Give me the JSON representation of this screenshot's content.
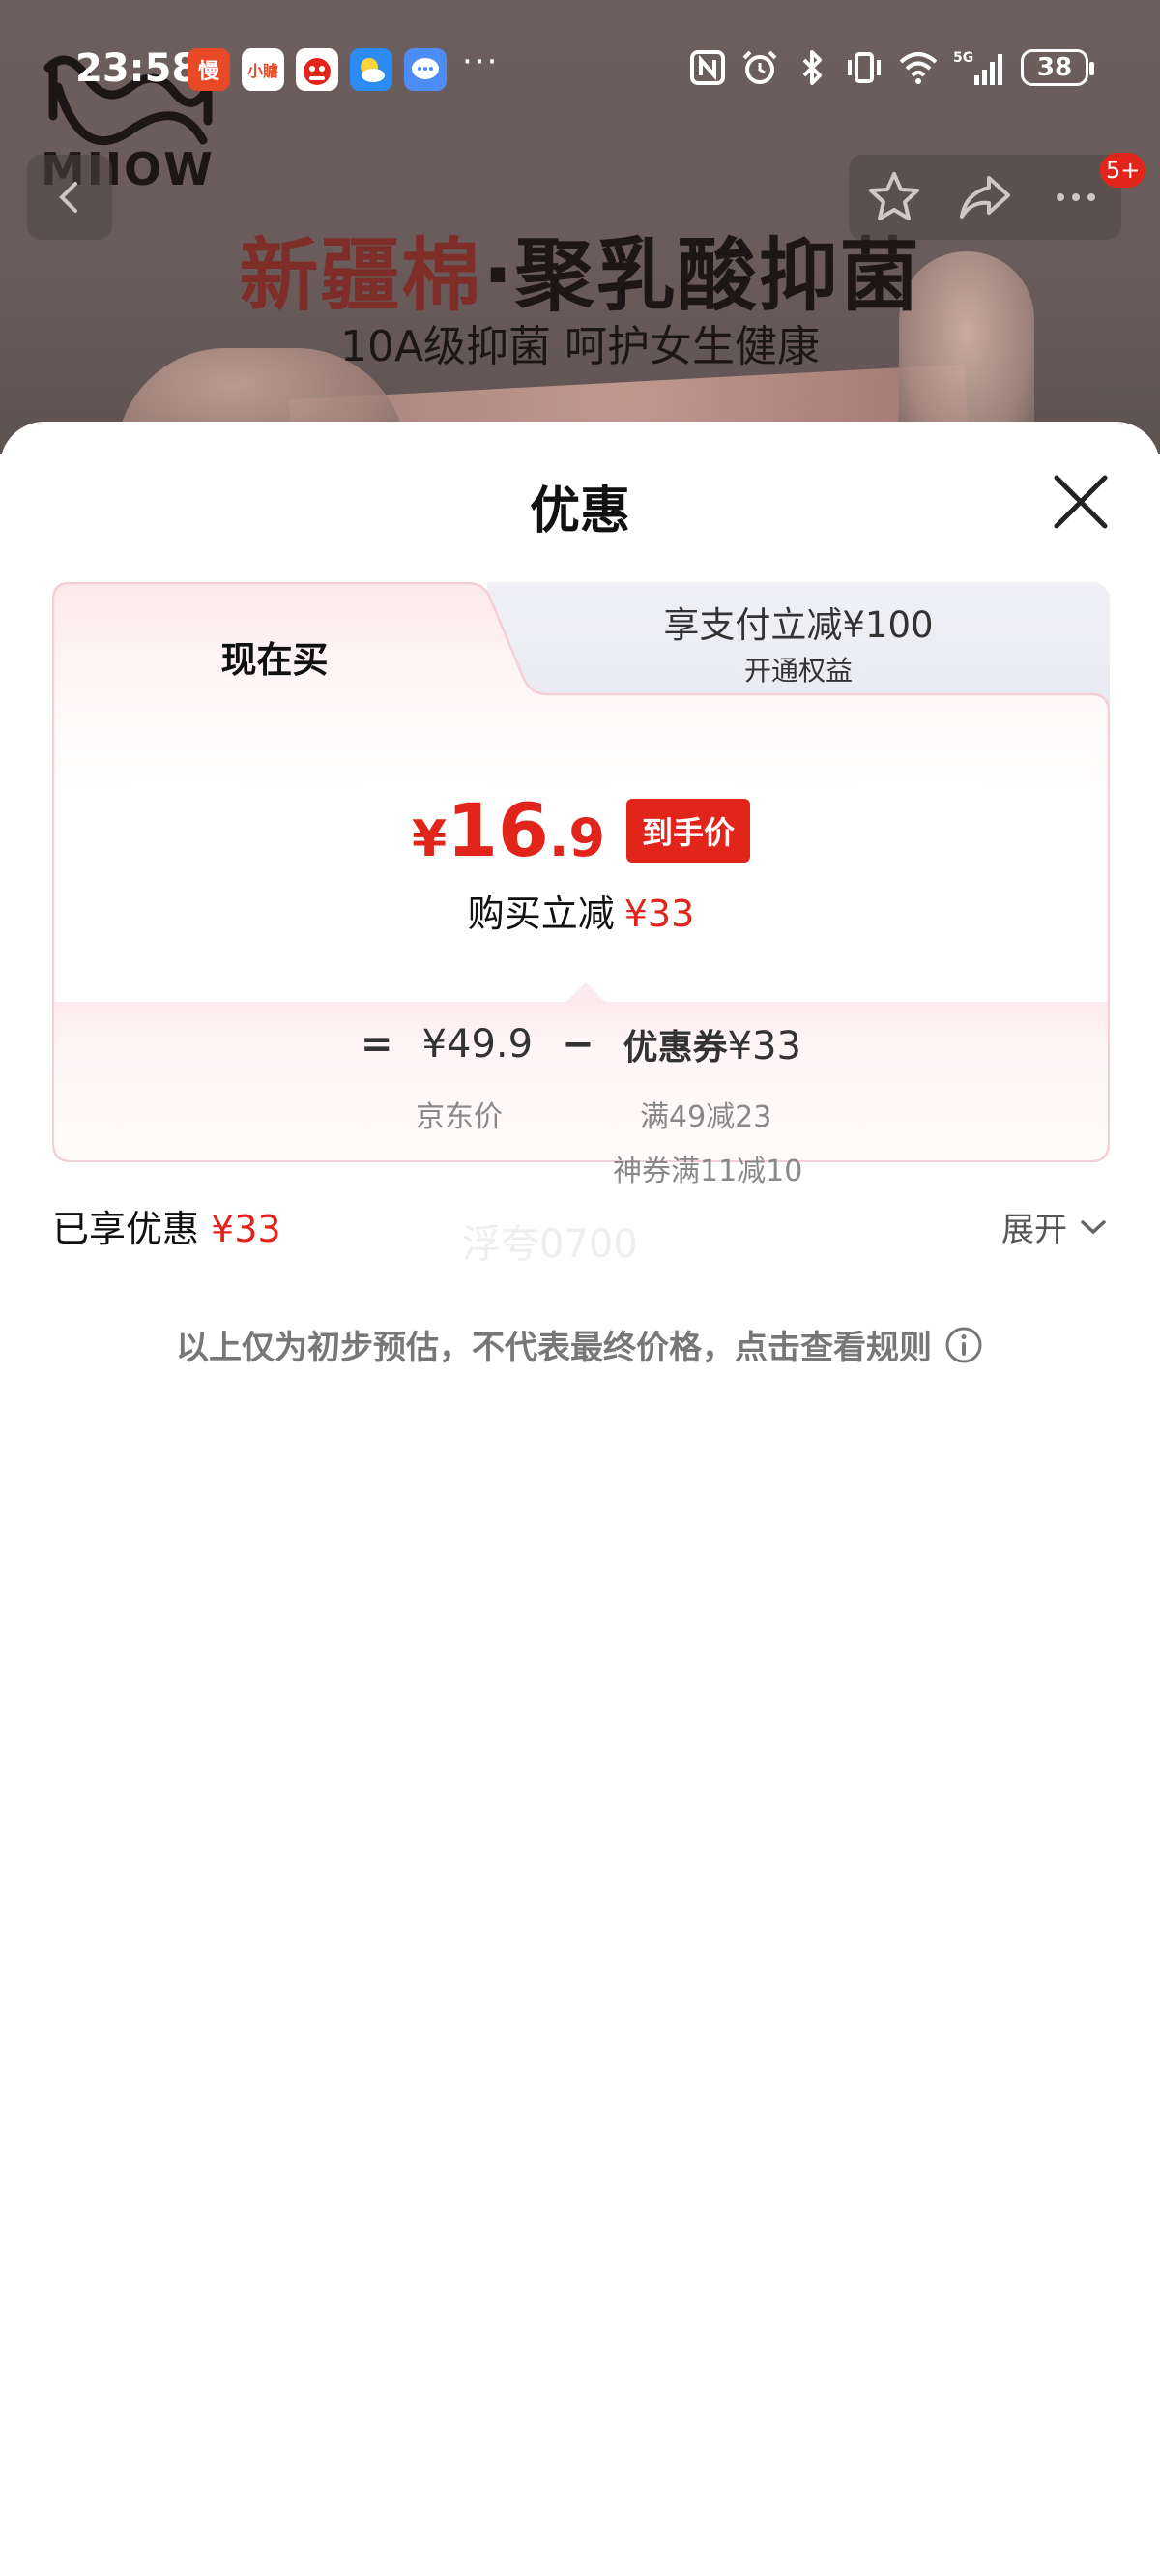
{
  "status_bar": {
    "time": "23:58",
    "apps": [
      {
        "name": "slow-app",
        "label": "慢",
        "color": "#e84a27"
      },
      {
        "name": "xiaohongshu-app",
        "label": "小䞊",
        "color": "#ffffff"
      },
      {
        "name": "jd-app",
        "label": "",
        "color": "#ffffff"
      },
      {
        "name": "weather-app",
        "label": "",
        "color": "#2b8cf3"
      },
      {
        "name": "messages-app",
        "label": "",
        "color": "#4c8cf5"
      }
    ],
    "more": "···",
    "network": "5G",
    "battery": "38"
  },
  "banner": {
    "logo_text": "MIIOW",
    "headline_accent": "新疆棉",
    "headline_rest": "·聚乳酸抑菌",
    "subline": "10A级抑菌 呵护女生健康"
  },
  "nav": {
    "badge": "5+"
  },
  "sheet": {
    "title": "优惠",
    "tabs": {
      "active": "现在买",
      "inactive_main": "享支付立减¥100",
      "inactive_sub": "开通权益"
    },
    "price": {
      "currency": "¥",
      "integer": "16",
      "decimal": ".9",
      "tag": "到手价"
    },
    "reduce": {
      "label": "购买立减",
      "amount": "¥33"
    },
    "formula": {
      "equals": "=",
      "jd_price": "¥49.9",
      "minus": "−",
      "coupon_word": "优惠券",
      "coupon_amount": "¥33",
      "jd_price_label": "京东价",
      "coupon_detail_1": "满49减23",
      "coupon_detail_2": "神券满11减10"
    },
    "enjoyed": {
      "label": "已享优惠",
      "amount": "¥33"
    },
    "watermark": "浮夸0700",
    "expand_label": "展开",
    "disclaimer": "以上仅为初步预估，不代表最终价格，点击查看规则"
  },
  "colors": {
    "accent_red": "#e1251b",
    "inactive_tab_bg": "#eeeff5",
    "formula_bg": "#fdeaee"
  }
}
